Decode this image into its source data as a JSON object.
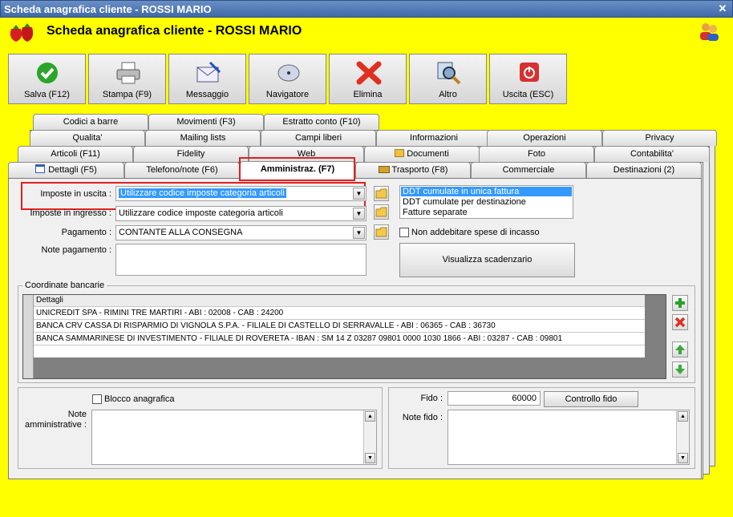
{
  "window": {
    "title": "Scheda anagrafica cliente - ROSSI MARIO",
    "close_glyph": "✕"
  },
  "header": {
    "title": "Scheda anagrafica cliente - ROSSI MARIO"
  },
  "toolbar": [
    {
      "label": "Salva (F12)",
      "icon": "check-icon"
    },
    {
      "label": "Stampa (F9)",
      "icon": "printer-icon"
    },
    {
      "label": "Messaggio",
      "icon": "envelope-icon"
    },
    {
      "label": "Navigatore",
      "icon": "compass-icon"
    },
    {
      "label": "Elimina",
      "icon": "delete-x-icon"
    },
    {
      "label": "Altro",
      "icon": "magnifier-icon"
    },
    {
      "label": "Uscita (ESC)",
      "icon": "power-icon"
    }
  ],
  "tabs": {
    "row1": [
      "Codici a barre",
      "Movimenti (F3)",
      "Estratto conto (F10)"
    ],
    "row2": [
      "Qualita'",
      "Mailing lists",
      "Campi liberi",
      "Informazioni",
      "Operazioni",
      "Privacy"
    ],
    "row3": [
      "Articoli (F11)",
      "Fidelity",
      "Web",
      "Documenti",
      "Foto",
      "Contabilita'"
    ],
    "row4": [
      "Dettagli (F5)",
      "Telefono/note (F6)",
      "Amministraz. (F7)",
      "Trasporto (F8)",
      "Commerciale",
      "Destinazioni (2)"
    ]
  },
  "form": {
    "imposte_uscita_label": "Imposte in uscita :",
    "imposte_uscita_value": "Utilizzare codice imposte categoria articoli",
    "imposte_ingresso_label": "Imposte in ingresso :",
    "imposte_ingresso_value": "Utilizzare codice imposte categoria articoli",
    "pagamento_label": "Pagamento :",
    "pagamento_value": "CONTANTE ALLA CONSEGNA",
    "note_pagamento_label": "Note pagamento :",
    "ddt_options": [
      "DDT cumulate in unica fattura",
      "DDT cumulate per destinazione",
      "Fatture separate"
    ],
    "non_addebitare_label": "Non addebitare spese di incasso",
    "visualizza_scadenzario": "Visualizza scadenzario"
  },
  "bank": {
    "group_label": "Coordinate bancarie",
    "column_header": "Dettagli",
    "rows": [
      "UNICREDIT SPA - RIMINI TRE MARTIRI - ABI : 02008 - CAB : 24200",
      "BANCA CRV CASSA DI RISPARMIO DI VIGNOLA S.P.A. - FILIALE DI CASTELLO DI SERRAVALLE - ABI : 06365 - CAB : 36730",
      "BANCA SAMMARINESE DI INVESTIMENTO - FILIALE DI ROVERETA - IBAN : SM 14 Z 03287 09801 0000 1030 1866 - ABI : 03287 - CAB : 09801"
    ]
  },
  "bottom": {
    "blocco_label": "Blocco anagrafica",
    "note_amm_label": "Note amministrative :",
    "fido_label": "Fido :",
    "fido_value": "60000",
    "controllo_fido": "Controllo fido",
    "note_fido_label": "Note fido :"
  },
  "colors": {
    "background": "#ffff00",
    "highlight": "#e02020",
    "selection": "#3399ff"
  }
}
